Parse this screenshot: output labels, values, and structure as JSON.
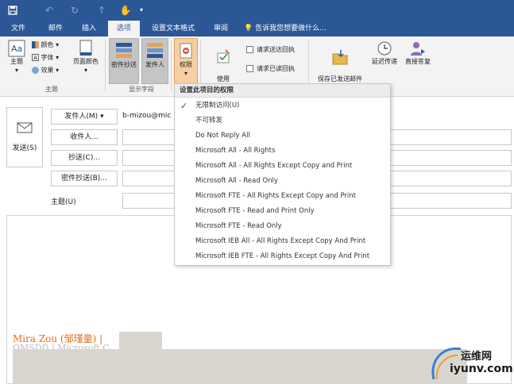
{
  "quick_access": {
    "save_icon": "save-icon",
    "undo_icon": "undo-icon",
    "redo_icon": "redo-icon",
    "touch_icon": "touch-mode-icon"
  },
  "tabs": [
    {
      "label": "文件"
    },
    {
      "label": "邮件"
    },
    {
      "label": "插入"
    },
    {
      "label": "选项"
    },
    {
      "label": "设置文本格式"
    },
    {
      "label": "审阅"
    }
  ],
  "tell_me": "告诉我您想要做什么...",
  "ribbon": {
    "theme_label": "主题",
    "colors_label": "颜色",
    "fonts_label": "字体",
    "effects_label": "效果",
    "page_color_label": "页面颜色",
    "group_theme": "主题",
    "bcc_label": "密件抄送",
    "from_label": "发件人",
    "group_show_fields": "显示字段",
    "permission_label": "权限",
    "voting_label": "使用\n投票按钮",
    "read_receipt_delivery": "请求送达回执",
    "read_receipt_read": "请求已读回执",
    "save_sent_label": "保存已发送邮件\n到",
    "delay_label": "延迟传递",
    "direct_reply_label": "直接答复"
  },
  "compose": {
    "send_label": "发送(S)",
    "from_button": "发件人(M)",
    "from_value": "b-mizou@mic",
    "to_button": "收件人...",
    "cc_button": "抄送(C)...",
    "bcc_button": "密件抄送(B)...",
    "subject_label": "主题(U)"
  },
  "signature": {
    "name": "Mira Zou (邹瑾童) |",
    "line2": "OMSDD | Microsoft C"
  },
  "permission_menu": {
    "header": "设置此项目的权限",
    "items": [
      {
        "label": "无限制访问(U)",
        "checked": true
      },
      {
        "label": "不可转发",
        "checked": false
      },
      {
        "label": "Do Not Reply All",
        "checked": false
      },
      {
        "label": "Microsoft All - All Rights",
        "checked": false
      },
      {
        "label": "Microsoft All - All Rights Except Copy and Print",
        "checked": false
      },
      {
        "label": "Microsoft All - Read Only",
        "checked": false
      },
      {
        "label": "Microsoft FTE - All Rights Except Copy and Print",
        "checked": false
      },
      {
        "label": "Microsoft FTE - Read and Print Only",
        "checked": false
      },
      {
        "label": "Microsoft FTE - Read Only",
        "checked": false
      },
      {
        "label": "Microsoft IEB All - All Rights Except Copy And Print",
        "checked": false
      },
      {
        "label": "Microsoft IEB FTE - All Rights Except Copy And Print",
        "checked": false
      }
    ]
  },
  "watermark": {
    "cn": "运维网",
    "en": "iyunv.com"
  }
}
